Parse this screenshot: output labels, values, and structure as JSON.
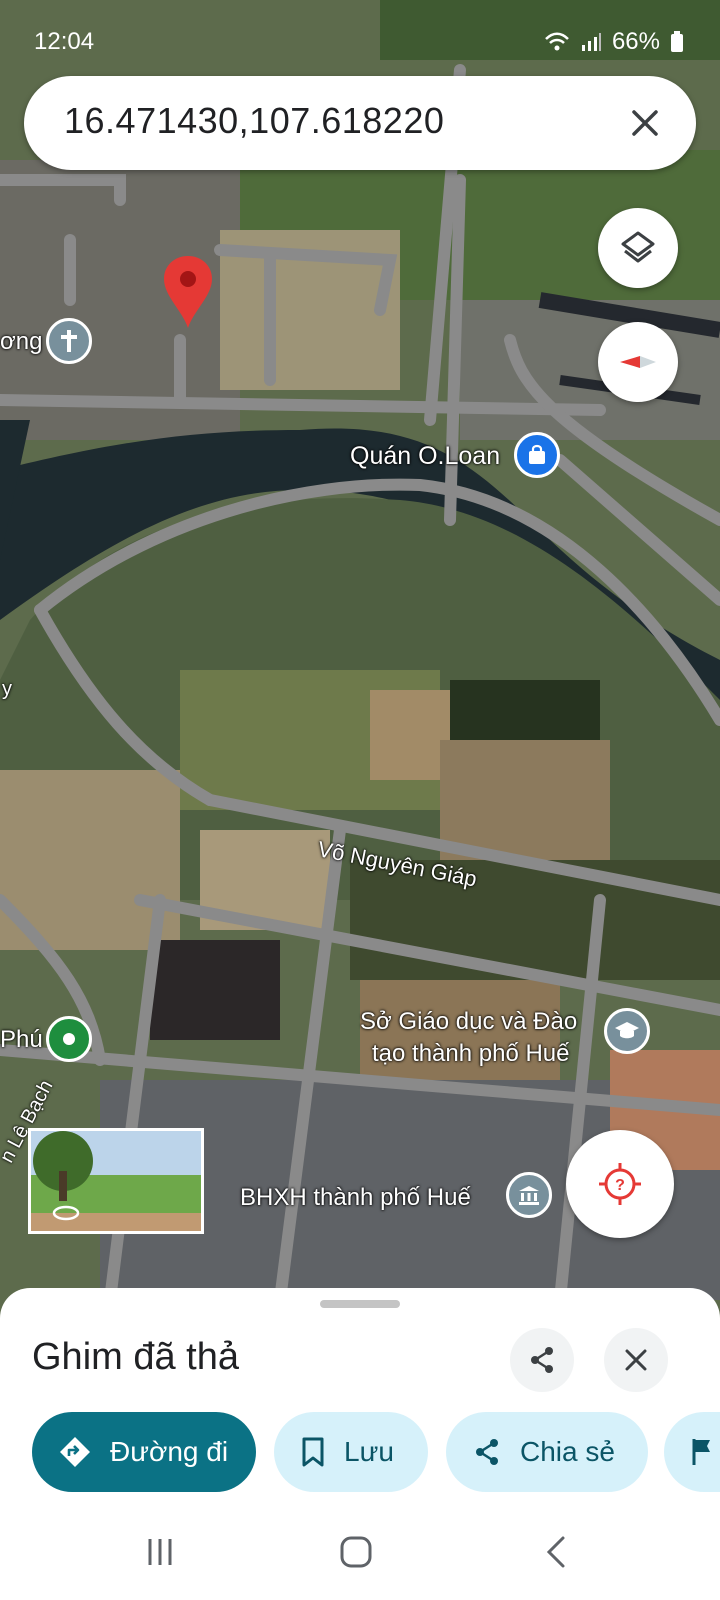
{
  "status_bar": {
    "time": "12:04",
    "battery": "66%",
    "icons": [
      "wifi-icon",
      "signal-icon",
      "battery-icon"
    ]
  },
  "search": {
    "query": "16.471430,107.618220",
    "clear_icon": "close-icon"
  },
  "map_controls": {
    "layers_icon": "layers-icon",
    "compass_icon": "compass-icon",
    "location_icon": "locate-icon"
  },
  "map": {
    "labels": {
      "church_partial": "ơng",
      "road_main": "Võ Nguyên Giáp",
      "left_partial": "Phú",
      "road_partial": "n Lê Bạch",
      "left_edge": "y"
    },
    "pois": {
      "shop": "Quán O.Loan",
      "education": "Sở Giáo dục và Đào tạo thành phố Huế",
      "education_line1": "Sở Giáo dục và Đào",
      "education_line2": "tạo thành phố Huế",
      "insurance": "BHXH thành phố Huế"
    },
    "colors": {
      "pin": "#e53935",
      "church": "#78909c",
      "shop": "#1a73e8",
      "park": "#1e8e3e",
      "education": "#78909c"
    }
  },
  "bottom_sheet": {
    "title": "Ghim đã thả",
    "share_icon": "share-icon",
    "close_icon": "close-icon",
    "chips": [
      {
        "label": "Đường đi",
        "icon": "directions-icon"
      },
      {
        "label": "Lưu",
        "icon": "bookmark-icon"
      },
      {
        "label": "Chia sẻ",
        "icon": "share-icon"
      },
      {
        "label": "",
        "icon": "flag-icon"
      }
    ],
    "colors": {
      "primary": "#0b7285",
      "chip_light": "#d6f1fa"
    }
  },
  "nav_bar": {
    "icons": [
      "recent-apps-icon",
      "home-icon",
      "back-icon"
    ]
  }
}
